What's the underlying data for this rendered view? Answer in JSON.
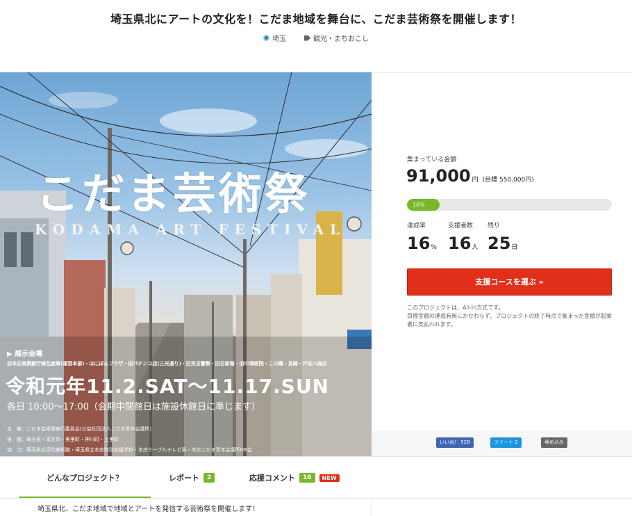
{
  "header": {
    "title": "埼玉県北にアートの文化を！こだま地域を舞台に、こだま芸術祭を開催します！",
    "location_tag": "埼玉",
    "category_tag": "観光・まちおこし"
  },
  "hero": {
    "title": "こだま芸術祭",
    "subtitle": "KODAMA ART FESTIVAL",
    "venue_label": "▶ 展示会場",
    "venue_list": "旧本庄商業銀行煉瓦倉庫(運営本部)・はにぽんプラザ・旧パチンコ店(三光通り)・旧児玉警察・旧日新館・旧中澤医院・この蔵・見聞・戸谷八商店",
    "date": "令和元年11.2.SAT～11.17.SUN",
    "hours": "各日 10:00～17:00（会期中閉館日は施設休館日に準じます）",
    "organizer": "主　催：こだま芸術祭実行委員会(公益社団法人こだま青年会議所)",
    "support": "後　援：埼玉県・本庄市・美里町・神川町・上里町",
    "cooperation": "協　力：埼玉県立近代美術館・埼玉県立本庄特別支援学校・本庄ケーブルテレビ局・本庄こだま青年会議所OB会"
  },
  "funding": {
    "raised_label": "集まっている金額",
    "amount": "91,000",
    "amount_unit": "円",
    "goal": "(目標 550,000円)",
    "progress_label": "16%",
    "progress_percent": 16,
    "stats": [
      {
        "label": "達成率",
        "value": "16",
        "unit": "%"
      },
      {
        "label": "支援者数",
        "value": "16",
        "unit": "人"
      },
      {
        "label": "残り",
        "value": "25",
        "unit": "日"
      }
    ],
    "cta_label": "支援コースを選ぶ »",
    "note_line1": "このプロジェクトは、All-In方式です。",
    "note_line2": "目標金額の達成有無にかかわらず、プロジェクトの終了時点で集まった金額が起案者に支払われます。"
  },
  "share": {
    "facebook": "いいね！ 528",
    "twitter": "ツイート 2",
    "embed": "埋め込み"
  },
  "tabs": {
    "about": "どんなプロジェクト？",
    "reports": "レポート",
    "reports_count": "2",
    "comments": "応援コメント",
    "comments_count": "16",
    "new_label": "NEW"
  },
  "description": "埼玉県北、こだま地域で地域とアートを発信する芸術祭を開催します！",
  "colors": {
    "accent_green": "#76b82a",
    "cta_red": "#e02f1b",
    "facebook_blue": "#4267b2",
    "twitter_blue": "#1b95e0"
  }
}
